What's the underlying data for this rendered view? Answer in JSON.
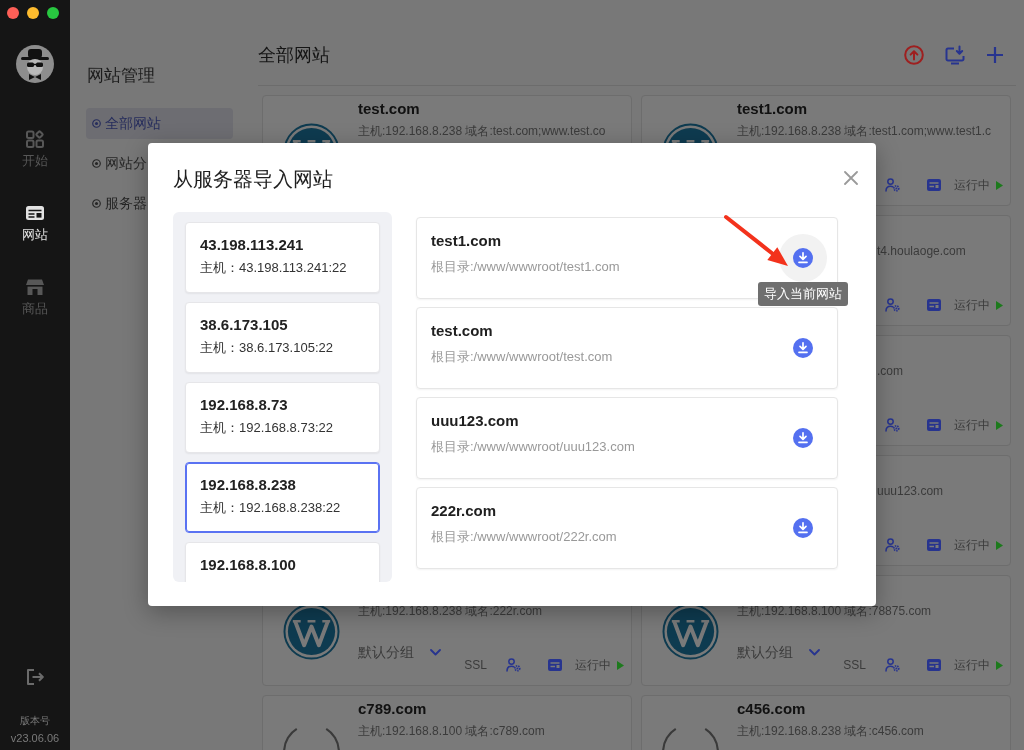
{
  "sidebar": {
    "items": [
      {
        "label": "开始",
        "kind": "apps",
        "selected": false
      },
      {
        "label": "网站",
        "kind": "sites",
        "selected": true
      },
      {
        "label": "商品",
        "kind": "store",
        "selected": false
      }
    ],
    "version_label": "版本号",
    "version": "v23.06.06"
  },
  "subnav": {
    "title": "网站管理",
    "items": [
      {
        "label": "全部网站",
        "selected": true
      },
      {
        "label": "网站分",
        "selected": false
      },
      {
        "label": "服务器",
        "selected": false
      }
    ]
  },
  "main": {
    "title": "全部网站",
    "rows": [
      {
        "cards": [
          {
            "kind": "wordpress",
            "title": "test.com",
            "host": "主机:192.168.8.238 域名:test.com;www.test.co"
          },
          {
            "kind": "wordpress",
            "title": "test1.com",
            "host": "主机:192.168.8.238 域名:test1.com;www.test1.c",
            "status": "运行中"
          }
        ]
      },
      {
        "cards": [
          {
            "kind": "covered",
            "host": "t4.houlaoge.com",
            "status": "运行中"
          }
        ]
      },
      {
        "cards": [
          {
            "kind": "covered",
            "host": ".com",
            "status": "运行中"
          }
        ]
      },
      {
        "cards": [
          {
            "kind": "covered",
            "host": "uuu123.com",
            "status": "运行中"
          }
        ]
      },
      {
        "cards": [
          {
            "kind": "wordpress",
            "host": "主机:192.168.8.238 域名:222r.com",
            "group": "默认分组",
            "ssl": "SSL",
            "status": "运行中"
          },
          {
            "kind": "wordpress",
            "host": "主机:192.168.8.100 域名:78875.com",
            "group": "默认分组",
            "ssl": "SSL",
            "status": "运行中"
          }
        ]
      },
      {
        "cards": [
          {
            "kind": "plain",
            "title": "c789.com",
            "host": "主机:192.168.8.100 域名:c789.com"
          },
          {
            "kind": "plain",
            "title": "c456.com",
            "host": "主机:192.168.8.238 域名:c456.com"
          }
        ]
      }
    ]
  },
  "dialog": {
    "title": "从服务器导入网站",
    "servers": [
      {
        "name": "43.198.113.241",
        "host": "主机：43.198.113.241:22",
        "selected": false
      },
      {
        "name": "38.6.173.105",
        "host": "主机：38.6.173.105:22",
        "selected": false
      },
      {
        "name": "192.168.8.73",
        "host": "主机：192.168.8.73:22",
        "selected": false
      },
      {
        "name": "192.168.8.238",
        "host": "主机：192.168.8.238:22",
        "selected": true
      },
      {
        "name": "192.168.8.100",
        "selected": false
      }
    ],
    "sites": [
      {
        "domain": "test1.com",
        "root": "根目录:/www/wwwroot/test1.com",
        "hovered": true,
        "tooltip": "导入当前网站"
      },
      {
        "domain": "test.com",
        "root": "根目录:/www/wwwroot/test.com",
        "hovered": false
      },
      {
        "domain": "uuu123.com",
        "root": "根目录:/www/wwwroot/uuu123.com",
        "hovered": false
      },
      {
        "domain": "222r.com",
        "root": "根目录:/www/wwwroot/222r.com",
        "hovered": false
      }
    ]
  }
}
